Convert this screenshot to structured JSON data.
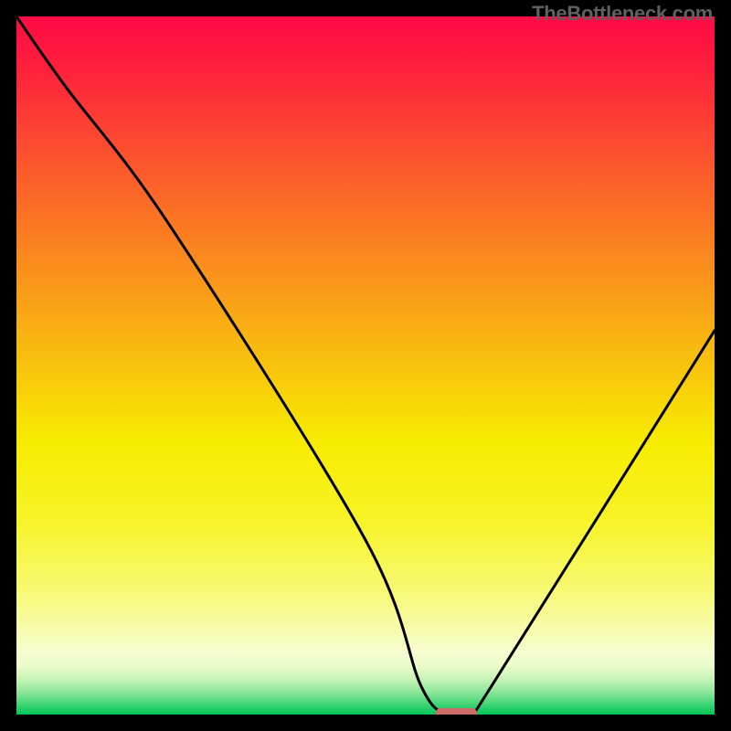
{
  "attribution": "TheBottleneck.com",
  "chart_data": {
    "type": "line",
    "title": "",
    "xlabel": "",
    "ylabel": "",
    "xlim": [
      0,
      100
    ],
    "ylim": [
      0,
      100
    ],
    "series": [
      {
        "name": "bottleneck-curve",
        "x": [
          0,
          7,
          22,
          50,
          58,
          62,
          65,
          68,
          100
        ],
        "y": [
          100,
          90,
          70,
          25,
          4,
          0,
          0,
          4,
          55
        ]
      }
    ],
    "marker": {
      "name": "optimal-range",
      "x_start": 60,
      "x_end": 66,
      "y": 0,
      "color": "#cf6a6a"
    },
    "gradient_stops": [
      {
        "offset": 0.0,
        "color": "#fe0b45"
      },
      {
        "offset": 0.06,
        "color": "#fe1b3e"
      },
      {
        "offset": 0.18,
        "color": "#fc4a30"
      },
      {
        "offset": 0.3,
        "color": "#fb7823"
      },
      {
        "offset": 0.42,
        "color": "#f9a516"
      },
      {
        "offset": 0.54,
        "color": "#f8d208"
      },
      {
        "offset": 0.61,
        "color": "#f7ec00"
      },
      {
        "offset": 0.72,
        "color": "#f7f326"
      },
      {
        "offset": 0.82,
        "color": "#f7f971"
      },
      {
        "offset": 0.88,
        "color": "#f7fbae"
      },
      {
        "offset": 0.91,
        "color": "#f6fdcf"
      },
      {
        "offset": 0.93,
        "color": "#eafbcb"
      },
      {
        "offset": 0.95,
        "color": "#c5f3b5"
      },
      {
        "offset": 0.97,
        "color": "#84e495"
      },
      {
        "offset": 0.985,
        "color": "#42d575"
      },
      {
        "offset": 1.0,
        "color": "#00c656"
      }
    ]
  }
}
